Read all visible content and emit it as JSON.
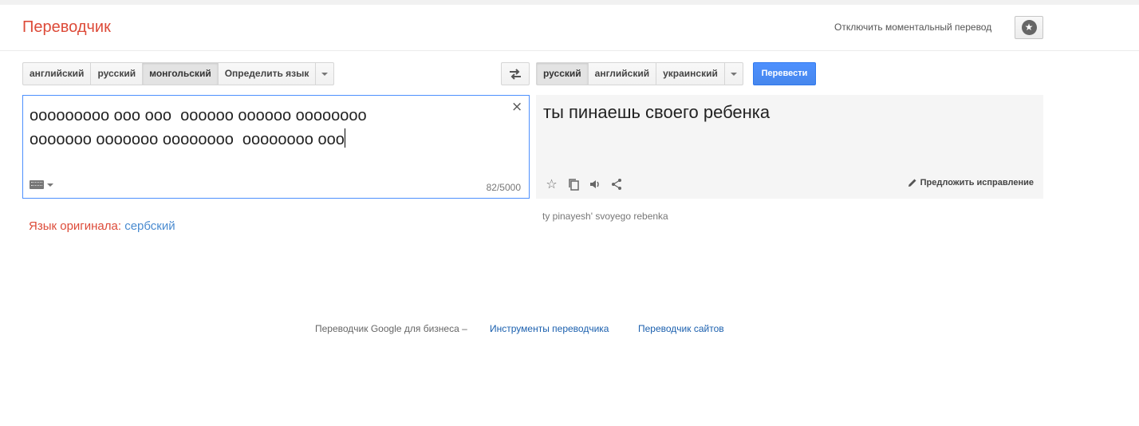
{
  "header": {
    "app_title": "Переводчик",
    "instant_toggle_label": "Отключить моментальный перевод",
    "star_icon": "star-icon"
  },
  "source": {
    "languages": [
      {
        "label": "английский",
        "active": false
      },
      {
        "label": "русский",
        "active": false
      },
      {
        "label": "монгольский",
        "active": true
      },
      {
        "label": "Определить язык",
        "active": false
      }
    ],
    "text_line1": "ooooooooo ooo ooo  oooooo oooooo oooooooo",
    "text_line2": "ooooooo ooooooo oooooooo  oooooooo ooo",
    "char_count": "82/5000",
    "clear_symbol": "×",
    "detected_prefix": "Язык оригинала:",
    "detected_language": "сербский"
  },
  "target": {
    "languages": [
      {
        "label": "русский",
        "active": true
      },
      {
        "label": "английский",
        "active": false
      },
      {
        "label": "украинский",
        "active": false
      }
    ],
    "translate_button": "Перевести",
    "translation": "ты пинаешь своего ребенка",
    "transliteration": "ty pinayesh' svoyego rebenka",
    "suggest_edit": "Предложить исправление"
  },
  "footer": {
    "prefix": "Переводчик Google для бизнеса –",
    "link_tools": "Инструменты переводчика",
    "link_sites": "Переводчик сайтов"
  }
}
